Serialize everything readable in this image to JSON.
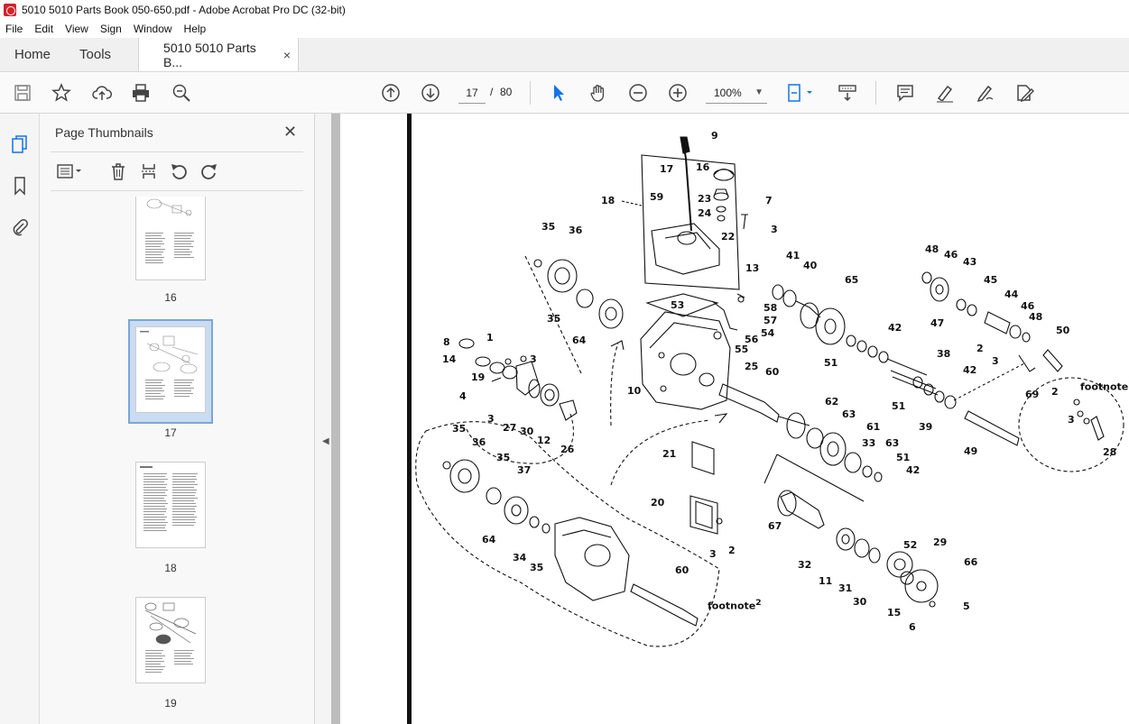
{
  "window": {
    "title": "5010 5010 Parts Book 050-650.pdf - Adobe Acrobat Pro DC (32-bit)"
  },
  "menu": [
    "File",
    "Edit",
    "View",
    "Sign",
    "Window",
    "Help"
  ],
  "tabs": {
    "home": "Home",
    "tools": "Tools",
    "document": "5010 5010 Parts B...",
    "close": "×"
  },
  "toolbar": {
    "current_page": "17",
    "page_separator": "/",
    "total_pages": "80",
    "zoom": "100%"
  },
  "panel": {
    "title": "Page Thumbnails",
    "close": "✕"
  },
  "thumbnails": [
    {
      "label": "16",
      "selected": false
    },
    {
      "label": "17",
      "selected": true
    },
    {
      "label": "18",
      "selected": false
    },
    {
      "label": "19",
      "selected": false
    }
  ],
  "diagram": {
    "labels": [
      "9",
      "16",
      "17",
      "18",
      "59",
      "23",
      "24",
      "7",
      "3",
      "22",
      "35",
      "36",
      "35",
      "64",
      "53",
      "13",
      "58",
      "57",
      "56",
      "54",
      "55",
      "41",
      "40",
      "65",
      "48",
      "46",
      "43",
      "45",
      "44",
      "46",
      "47",
      "48",
      "50",
      "42",
      "8",
      "1",
      "14",
      "19",
      "3",
      "4",
      "3",
      "27",
      "30",
      "12",
      "26",
      "25",
      "10",
      "60",
      "51",
      "38",
      "2",
      "3",
      "42",
      "69",
      "51",
      "39",
      "62",
      "63",
      "61",
      "33",
      "63",
      "51",
      "42",
      "49",
      "footnote",
      "2",
      "3",
      "28",
      "35",
      "36",
      "35",
      "37",
      "64",
      "34",
      "35",
      "21",
      "20",
      "3",
      "2",
      "67",
      "32",
      "11",
      "31",
      "30",
      "52",
      "29",
      "66",
      "15",
      "5",
      "6",
      "60",
      "footnote"
    ],
    "footnote_superscript": "2"
  },
  "colors": {
    "accent": "#1473e6",
    "selection": "#c9dcf1",
    "acrobat_red": "#d4232b"
  }
}
